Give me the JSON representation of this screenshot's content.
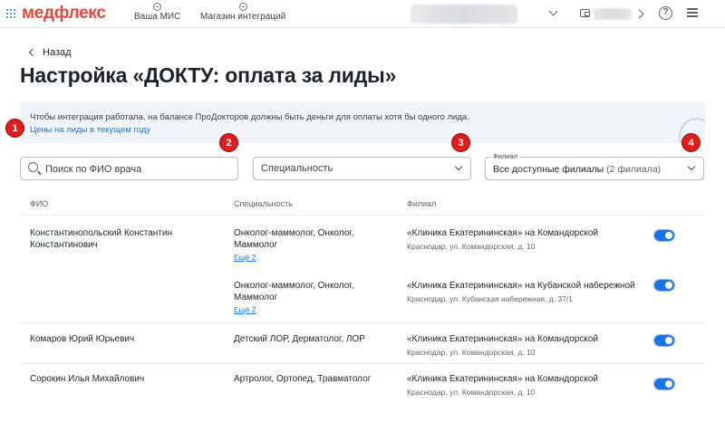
{
  "topbar": {
    "logo": "медфлекс",
    "nav": [
      {
        "label": "Ваша МИС",
        "icon": "arrow-in-circle-icon"
      },
      {
        "label": "Магазин интеграций",
        "icon": "arrow-in-circle-icon"
      }
    ]
  },
  "back_label": "Назад",
  "page_title": "Настройка «ДОКТУ: оплата за лиды»",
  "banner": {
    "text": "Чтобы интеграция работала, на балансе ПроДокторов должны быть деньги для оплаты хотя бы одного лида.",
    "link": "Цены на лиды в текущем году"
  },
  "badges": [
    "1",
    "2",
    "3",
    "4"
  ],
  "filters": {
    "search_placeholder": "Поиск по ФИО врача",
    "specialty_placeholder": "Специальность",
    "branch_legend": "Филиал",
    "branch_value": "Все доступные филиалы",
    "branch_count": "(2 филиала)"
  },
  "table": {
    "headers": [
      "ФИО",
      "Специальность",
      "Филиал"
    ],
    "rows": [
      {
        "name": "Константинопольский Константин Константинович",
        "entries": [
          {
            "specialty": "Онколог-маммолог, Онколог, Маммолог",
            "more": "Ещё 2",
            "branch": "«Клиника Екатерининская» на Командорской",
            "address": "Краснодар, ул. Командорская, д. 10",
            "enabled": true
          },
          {
            "specialty": "Онколог-маммолог, Онколог, Маммолог",
            "more": "Ещё 2",
            "branch": "«Клиника Екатерининская» на Кубанской набережной",
            "address": "Краснодар, ул. Кубанская набережная, д. 37/1",
            "enabled": true
          }
        ]
      },
      {
        "name": "Комаров Юрий Юрьевич",
        "entries": [
          {
            "specialty": "Детский ЛОР, Дерматолог, ЛОР",
            "branch": "«Клиника Екатерининская» на Командорской",
            "address": "Краснодар, ул. Командорская, д. 10",
            "enabled": true
          }
        ]
      },
      {
        "name": "Сорокин Илья Михайлович",
        "entries": [
          {
            "specialty": "Артролог, Ортопед, Травматолог",
            "branch": "«Клиника Екатерининская» на Командорской",
            "address": "Краснодар, ул. Командорская, д. 10",
            "enabled": true
          }
        ]
      }
    ]
  },
  "colors": {
    "brand": "#e8453c",
    "accent": "#1a73e8",
    "badge": "#e21b1b",
    "banner_bg": "#f1f5fb"
  }
}
